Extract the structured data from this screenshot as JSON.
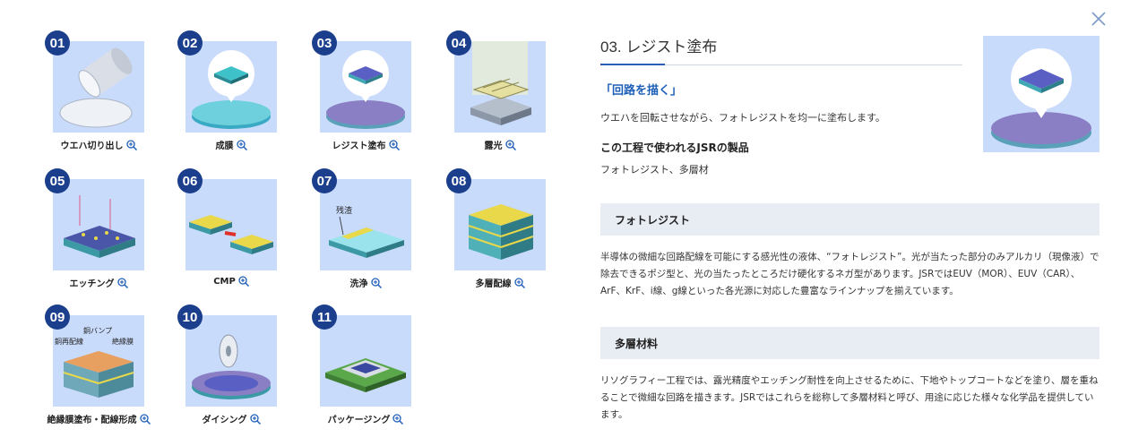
{
  "steps": [
    {
      "num": "01",
      "label": "ウエハ切り出し"
    },
    {
      "num": "02",
      "label": "成膜"
    },
    {
      "num": "03",
      "label": "レジスト塗布"
    },
    {
      "num": "04",
      "label": "露光"
    },
    {
      "num": "05",
      "label": "エッチング"
    },
    {
      "num": "06",
      "label": "CMP"
    },
    {
      "num": "07",
      "label": "洗浄"
    },
    {
      "num": "08",
      "label": "多層配線"
    },
    {
      "num": "09",
      "label": "絶縁膜塗布・配線形成"
    },
    {
      "num": "10",
      "label": "ダイシング"
    },
    {
      "num": "11",
      "label": "パッケージング"
    }
  ],
  "illustration_labels": {
    "residue": "残渣",
    "copper_bump": "銅バンプ",
    "copper_rewiring": "銅再配線",
    "insulating_film": "絶縁膜"
  },
  "detail": {
    "title": "03. レジスト塗布",
    "subtitle": "「回路を描く」",
    "description": "ウエハを回転させながら、フォトレジストを均一に塗布します。",
    "products_heading": "この工程で使われるJSRの製品",
    "products": "フォトレジスト、多層材",
    "sections": [
      {
        "heading": "フォトレジスト",
        "lines": [
          "半導体の微細な回路配線を可能にする感光性の液体、“フォトレジスト”。光が当たった部分のみアルカリ（現像液）で",
          "除去できるポジ型と、光の当たったところだけ硬化するネガ型があります。JSRではEUV（MOR）、EUV（CAR）、",
          "ArF、KrF、i線、g線といった各光源に対応した豊富なラインナップを揃えています。"
        ]
      },
      {
        "heading": "多層材料",
        "lines": [
          "リソグラフィー工程では、露光精度やエッチング耐性を向上させるために、下地やトップコートなどを塗り、層を重ね",
          "ることで微細な回路を描きます。JSRではこれらを総称して多層材料と呼び、用途に応じた様々な化学品を提供してい",
          "ます。"
        ]
      }
    ]
  },
  "colors": {
    "badge": "#1b3f8c",
    "thumb_bg": "#c9dbfb",
    "accent": "#1d5fb8",
    "section_bg": "#e8ecf3"
  }
}
